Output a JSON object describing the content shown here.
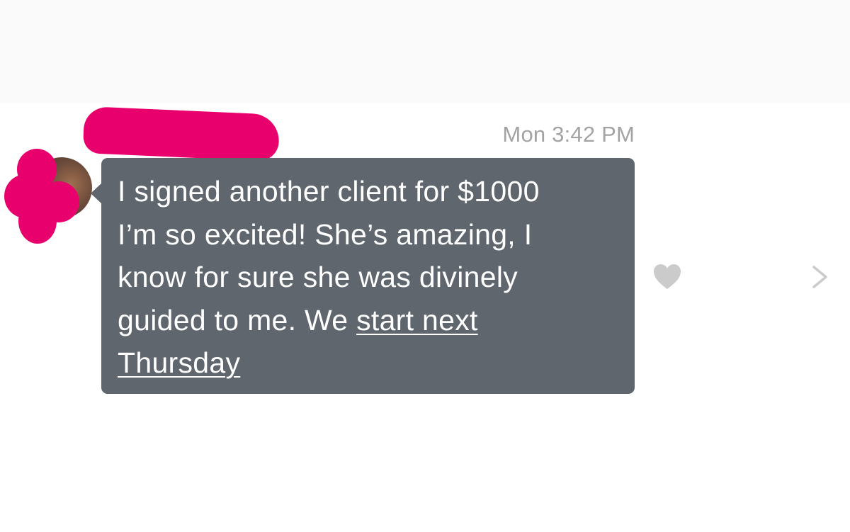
{
  "conversation": {
    "timestamp": "Mon 3:42 PM",
    "message": {
      "text_before_link": "I signed another client for $1000\nI’m so excited! She’s amazing, I\nknow for sure she was divinely\nguided to me. We ",
      "link_text": "start next\nThursday"
    }
  },
  "actions": {
    "like_icon": "heart-icon",
    "open_icon": "chevron-right-icon"
  },
  "colors": {
    "bubble": "#5f666d",
    "redaction": "#e8006d",
    "timestamp": "#a3a3a3",
    "icons": "#cbcbcb"
  }
}
